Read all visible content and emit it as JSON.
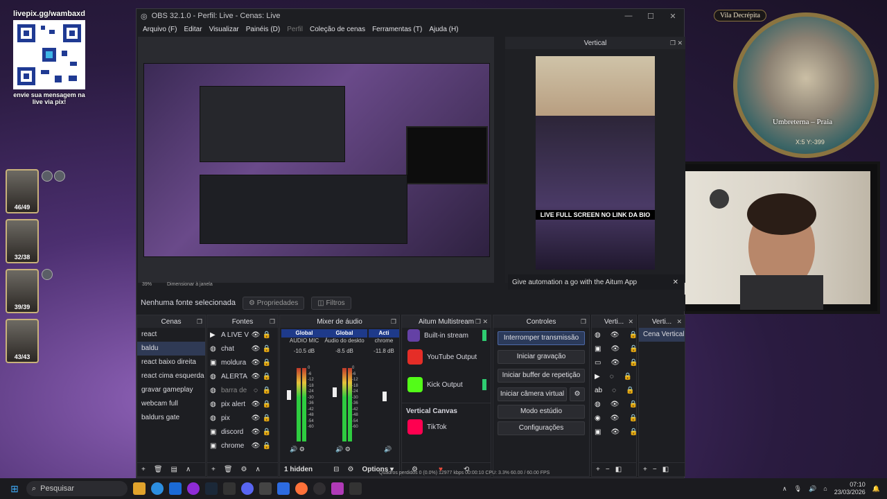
{
  "overlay": {
    "qr_url": "livepix.gg/wambaxd",
    "qr_caption": "envie sua mensagem na live via pix!",
    "party": [
      {
        "hp": "46/49"
      },
      {
        "hp": "32/38"
      },
      {
        "hp": "39/39"
      },
      {
        "hp": "43/43"
      }
    ],
    "map_location_top": "Vila Decrépita",
    "map_location": "Umbreterna – Praia",
    "map_coords": "X:5 Y:-399"
  },
  "obs": {
    "title": "OBS 32.1.0 - Perfil: Live - Cenas: Live",
    "menu": [
      "Arquivo (F)",
      "Editar",
      "Visualizar",
      "Painéis (D)",
      "Perfil",
      "Coleção de cenas",
      "Ferramentas (T)",
      "Ajuda (H)"
    ],
    "zoom": "39%",
    "zoom_mode": "Dimensionar à janela",
    "no_source": "Nenhuma fonte selecionada",
    "properties": "Propriedades",
    "filters": "Filtros",
    "vertical_title": "Vertical",
    "vertical_banner": "LIVE FULL SCREEN NO LINK DA BIO",
    "aitum_notice": "Give automation a go with the Aitum App",
    "docks": {
      "scenes": {
        "title": "Cenas",
        "items": [
          "react",
          "baldu",
          "react baixo direita",
          "react cima esquerda",
          "gravar gameplay",
          "webcam full",
          "baldurs gate"
        ],
        "selected": 1
      },
      "sources": {
        "title": "Fontes",
        "items": [
          "A LIVE V",
          "chat",
          "moldura",
          "ALERTA",
          "barra de",
          "pix alert",
          "pix",
          "discord",
          "chrome"
        ]
      },
      "mixer": {
        "title": "Mixer de áudio",
        "channels": [
          {
            "scope": "Global",
            "name": "AUDIO MIC",
            "db": "-10.5 dB"
          },
          {
            "scope": "Global",
            "name": "Áudio do deskto",
            "db": "-8.5 dB"
          },
          {
            "scope": "Acti",
            "name": "chrome",
            "db": "-11.8 dB"
          }
        ],
        "scale": [
          "0",
          "-6",
          "-12",
          "-18",
          "-24",
          "-30",
          "-36",
          "-42",
          "-48",
          "-54",
          "-60"
        ],
        "hidden": "1 hidden",
        "options": "Options"
      },
      "aitum": {
        "title": "Aitum Multistream",
        "outputs": [
          "Built-in stream",
          "YouTube Output",
          "Kick Output"
        ],
        "vertical_canvas": "Vertical Canvas",
        "vertical_outputs": [
          "TikTok"
        ]
      },
      "controls": {
        "title": "Controles",
        "buttons": [
          "Interromper transmissão",
          "Iniciar gravação",
          "Iniciar buffer de repetição",
          "Iniciar câmera virtual",
          "Modo estúdio",
          "Configurações"
        ]
      },
      "vert_sources": {
        "title": "Verti..."
      },
      "vert_scenes": {
        "title": "Verti...",
        "items": [
          "Cena Vertical"
        ]
      }
    },
    "status": "Quadros perdidos 0 (0.0%)  12977 kbps  00:00:10  CPU: 3.3%  60.00 / 60.00 FPS"
  },
  "taskbar": {
    "search_placeholder": "Pesquisar",
    "time": "07:10",
    "date": "23/03/2026"
  },
  "colors": {
    "accent": "#2b3a5a",
    "live_green": "#2ecc71",
    "mixer_blue": "#1e3a8a"
  }
}
